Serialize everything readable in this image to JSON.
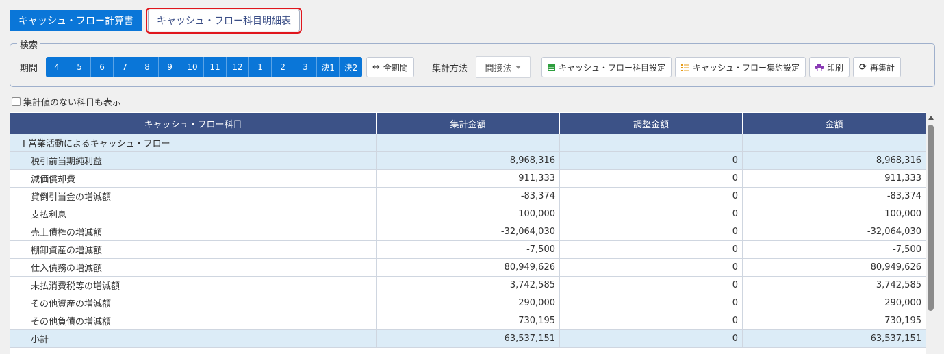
{
  "tabs": [
    {
      "label": "キャッシュ・フロー計算書"
    },
    {
      "label": "キャッシュ・フロー科目明細表"
    }
  ],
  "search": {
    "legend": "検索",
    "period_label": "期間",
    "months": [
      "4",
      "5",
      "6",
      "7",
      "8",
      "9",
      "10",
      "11",
      "12",
      "1",
      "2",
      "3",
      "決1",
      "決2"
    ],
    "all_period": "全期間",
    "method_label": "集計方法",
    "method_value": "間接法",
    "btn_account_setting": "キャッシュ・フロー科目設定",
    "btn_summary_setting": "キャッシュ・フロー集約設定",
    "btn_print": "印刷",
    "btn_recalc": "再集計"
  },
  "show_empty_label": "集計値のない科目も表示",
  "table": {
    "headers": [
      "キャッシュ・フロー科目",
      "集計金額",
      "調整金額",
      "金額"
    ],
    "rows": [
      {
        "name": "I 営業活動によるキャッシュ・フロー",
        "total": "",
        "adj": "",
        "amount": ""
      },
      {
        "name": "税引前当期純利益",
        "total": "8,968,316",
        "adj": "0",
        "amount": "8,968,316"
      },
      {
        "name": "減価償却費",
        "total": "911,333",
        "adj": "0",
        "amount": "911,333"
      },
      {
        "name": "貸倒引当金の増減額",
        "total": "-83,374",
        "adj": "0",
        "amount": "-83,374"
      },
      {
        "name": "支払利息",
        "total": "100,000",
        "adj": "0",
        "amount": "100,000"
      },
      {
        "name": "売上債権の増減額",
        "total": "-32,064,030",
        "adj": "0",
        "amount": "-32,064,030"
      },
      {
        "name": "棚卸資産の増減額",
        "total": "-7,500",
        "adj": "0",
        "amount": "-7,500"
      },
      {
        "name": "仕入債務の増減額",
        "total": "80,949,626",
        "adj": "0",
        "amount": "80,949,626"
      },
      {
        "name": "未払消費税等の増減額",
        "total": "3,742,585",
        "adj": "0",
        "amount": "3,742,585"
      },
      {
        "name": "その他資産の増減額",
        "total": "290,000",
        "adj": "0",
        "amount": "290,000"
      },
      {
        "name": "その他負債の増減額",
        "total": "730,195",
        "adj": "0",
        "amount": "730,195"
      },
      {
        "name": "小計",
        "total": "63,537,151",
        "adj": "0",
        "amount": "63,537,151"
      }
    ]
  }
}
